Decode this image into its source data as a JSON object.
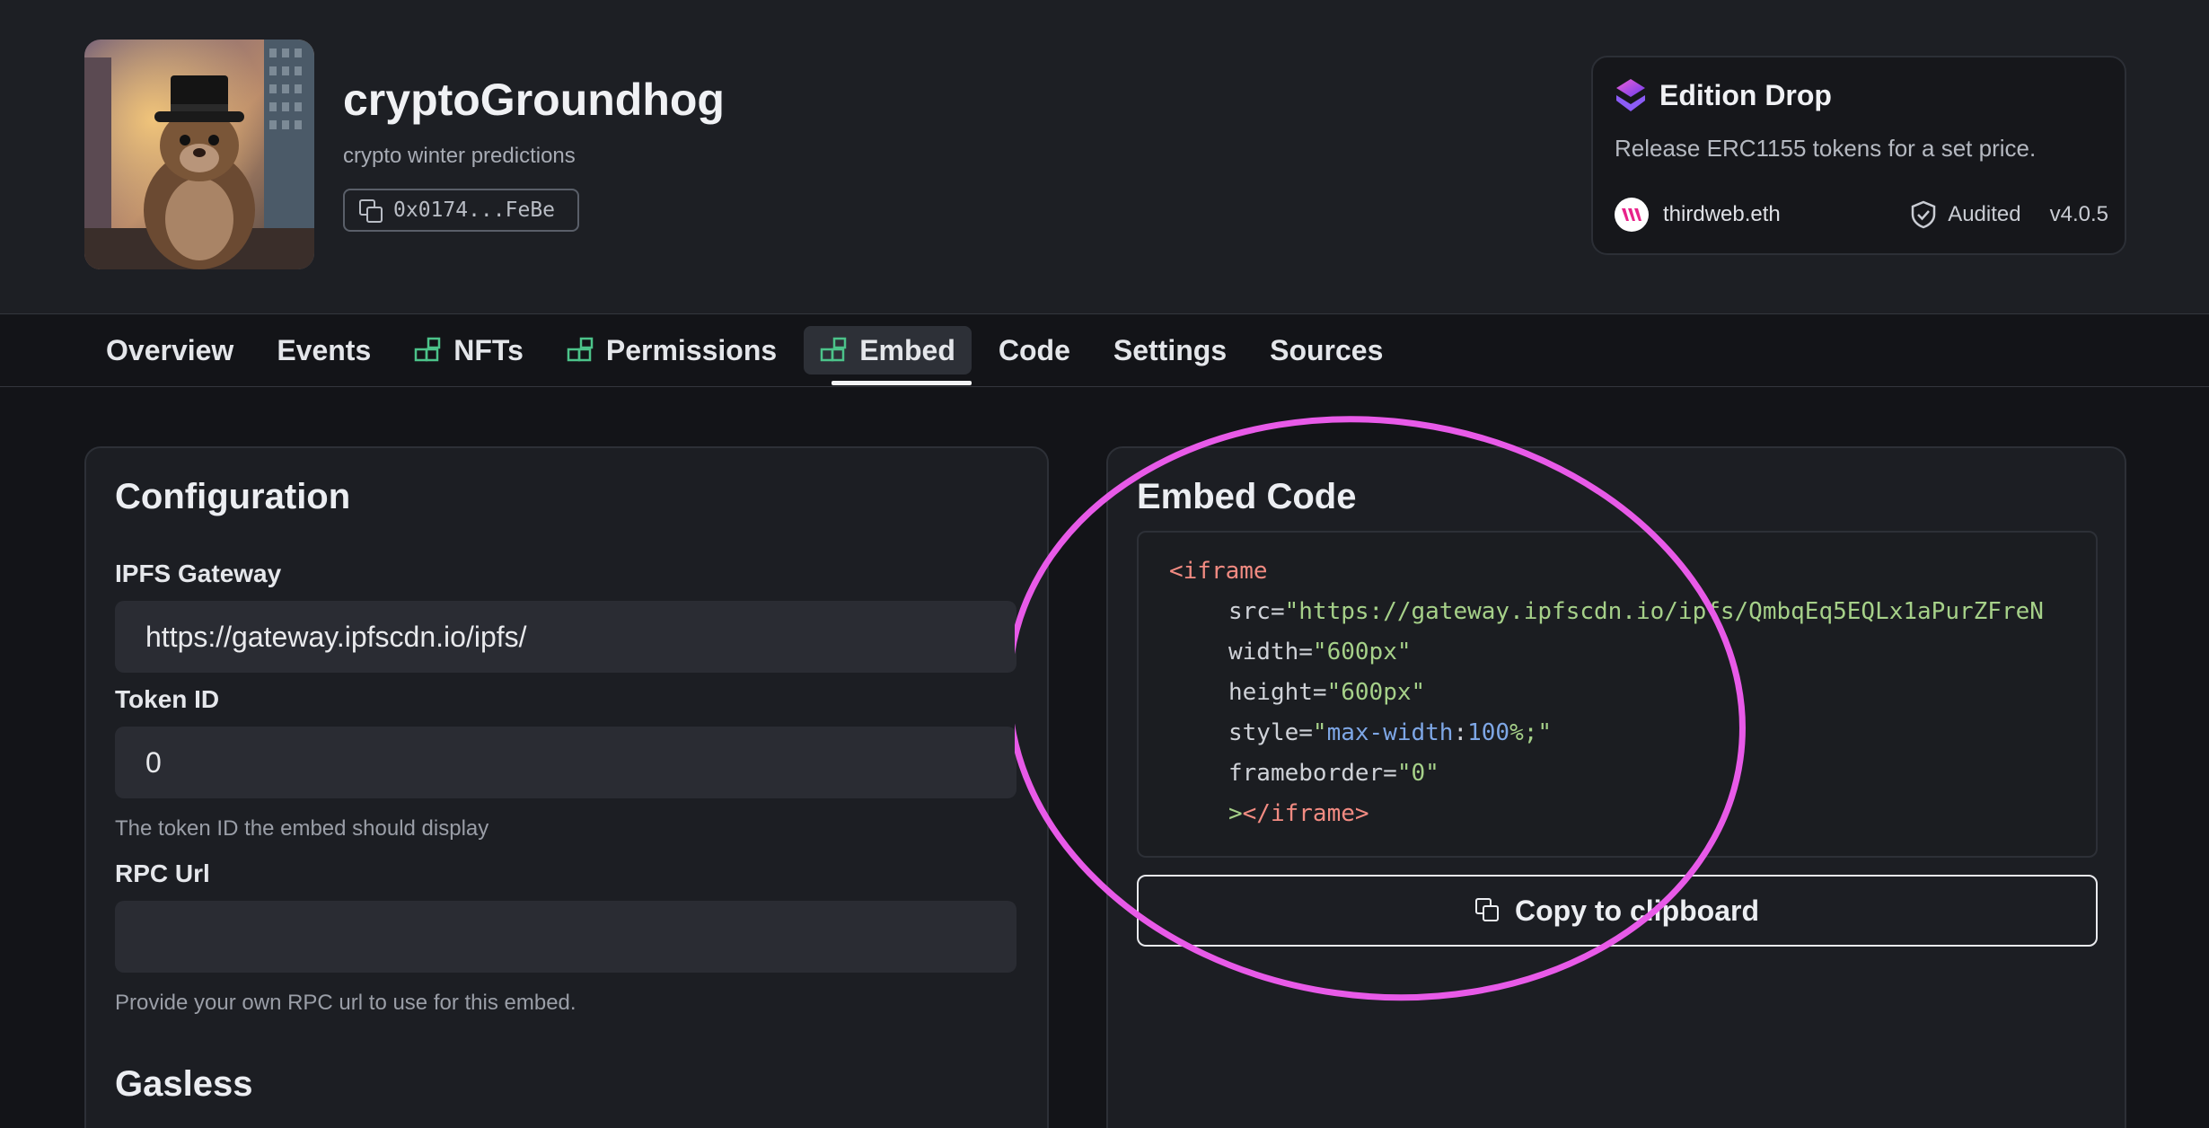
{
  "contract": {
    "name": "cryptoGroundhog",
    "description": "crypto winter predictions",
    "address": "0x0174...FeBe"
  },
  "edition_card": {
    "title": "Edition Drop",
    "description": "Release ERC1155 tokens for a set price.",
    "publisher": "thirdweb.eth",
    "audited": "Audited",
    "version": "v4.0.5"
  },
  "tabs": [
    {
      "label": "Overview",
      "icon": ""
    },
    {
      "label": "Events",
      "icon": ""
    },
    {
      "label": "NFTs",
      "icon": "extension-grid-icon"
    },
    {
      "label": "Permissions",
      "icon": "extension-grid-icon"
    },
    {
      "label": "Embed",
      "icon": "extension-grid-icon",
      "active": true
    },
    {
      "label": "Code",
      "icon": ""
    },
    {
      "label": "Settings",
      "icon": ""
    },
    {
      "label": "Sources",
      "icon": ""
    }
  ],
  "configuration": {
    "title": "Configuration",
    "ipfs_label": "IPFS Gateway",
    "ipfs_value": "https://gateway.ipfscdn.io/ipfs/",
    "token_label": "Token ID",
    "token_value": "0",
    "token_helper": "The token ID the embed should display",
    "rpc_label": "RPC Url",
    "rpc_value": "",
    "rpc_helper": "Provide your own RPC url to use for this embed.",
    "gasless_title": "Gasless"
  },
  "embed": {
    "title": "Embed Code",
    "copy_label": "Copy to clipboard",
    "code": {
      "open_tag": "<iframe",
      "src_attr": "src=",
      "src_value": "\"https://gateway.ipfscdn.io/ipfs/QmbqEq5EQLx1aPurZFreN",
      "width_attr": "width=",
      "width_value": "\"600px\"",
      "height_attr": "height=",
      "height_value": "\"600px\"",
      "style_attr": "style=",
      "style_q1": "\"",
      "style_prop": "max-width",
      "style_colon": ":",
      "style_num": "100",
      "style_tail": "%;\"",
      "frameborder_attr": "frameborder=",
      "frameborder_value": "\"0\"",
      "close_gt": ">",
      "close_tag": "</iframe>"
    }
  },
  "colors": {
    "highlight": "#e85ae8",
    "accent_green": "#4cc38a"
  }
}
